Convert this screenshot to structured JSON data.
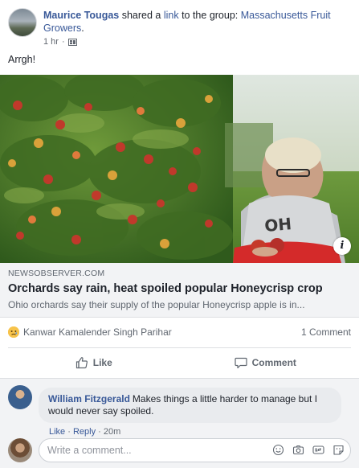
{
  "post": {
    "author": "Maurice Tougas",
    "action_text": " shared a ",
    "link_word": "link",
    "to_text": " to the group: ",
    "group": "Massachusetts Fruit Growers",
    "group_suffix": ".",
    "time": "1 hr",
    "dot": "·",
    "message": "Arrgh!"
  },
  "link_preview": {
    "source": "NEWSOBSERVER.COM",
    "headline": "Orchards say rain, heat spoiled popular Honeycrisp crop",
    "description": "Ohio orchards say their supply of the popular Honeycrisp apple is in...",
    "info_glyph": "i"
  },
  "reactions": {
    "reactor": "Kanwar Kamalender Singh Parihar",
    "comment_count": "1 Comment"
  },
  "actions": {
    "like_label": "Like",
    "comment_label": "Comment"
  },
  "comments": [
    {
      "author": "William Fitzgerald",
      "text": "Makes things a little harder to manage but I would never say spoiled.",
      "like_label": "Like",
      "reply_label": "Reply",
      "sep": " · ",
      "time": "20m"
    }
  ],
  "composer": {
    "placeholder": "Write a comment..."
  },
  "colors": {
    "link_blue": "#385898",
    "secondary_text": "#606770",
    "caption_bg": "#f2f3f5"
  }
}
